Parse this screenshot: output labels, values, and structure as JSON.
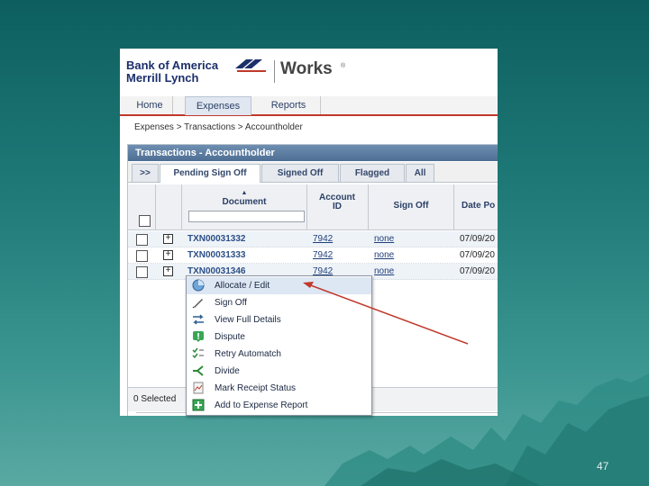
{
  "slide": {
    "number": "47"
  },
  "brand": {
    "bank_line1": "Bank of America",
    "bank_line2": "Merrill Lynch",
    "product": "Works",
    "reg": "®"
  },
  "nav": {
    "tabs": [
      "Home",
      "Expenses",
      "Reports"
    ],
    "active": "Expenses"
  },
  "breadcrumb": "Expenses  >  Transactions  >  Accountholder",
  "panel": {
    "title": "Transactions - Accountholder",
    "subtabs": [
      ">>",
      "Pending Sign Off",
      "Signed Off",
      "Flagged",
      "All"
    ],
    "active_subtab": "Pending Sign Off"
  },
  "grid": {
    "columns": [
      "Document",
      "Account ID",
      "Sign Off",
      "Date Po"
    ],
    "rows": [
      {
        "document": "TXN00031332",
        "account_id": "7942",
        "sign_off": "none",
        "date": "07/09/20"
      },
      {
        "document": "TXN00031333",
        "account_id": "7942",
        "sign_off": "none",
        "date": "07/09/20"
      },
      {
        "document": "TXN00031346",
        "account_id": "7942",
        "sign_off": "none",
        "date": "07/09/20"
      }
    ],
    "selected_count": "0 Selected"
  },
  "context_menu": {
    "items": [
      {
        "label": "Allocate / Edit",
        "icon": "pie-chart-icon"
      },
      {
        "label": "Sign Off",
        "icon": "pen-icon"
      },
      {
        "label": "View Full Details",
        "icon": "arrows-icon"
      },
      {
        "label": "Dispute",
        "icon": "alert-icon"
      },
      {
        "label": "Retry Automatch",
        "icon": "checklist-icon"
      },
      {
        "label": "Divide",
        "icon": "split-icon"
      },
      {
        "label": "Mark Receipt Status",
        "icon": "receipt-icon"
      },
      {
        "label": "Add to Expense Report",
        "icon": "report-add-icon"
      }
    ],
    "highlighted": "Allocate / Edit"
  },
  "colors": {
    "accent_red": "#c0392b",
    "link_blue": "#1f3f7a",
    "header_blue": "#4d6e93"
  }
}
